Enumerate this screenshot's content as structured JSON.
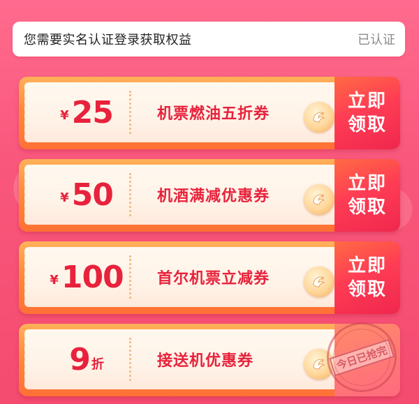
{
  "verify": {
    "text": "您需要实名认证登录获取权益",
    "status": "已认证"
  },
  "coupons": [
    {
      "currency": "¥",
      "value": "25",
      "unit": "",
      "title": "机票燃油五折券",
      "claim_line1": "立即",
      "claim_line2": "领取",
      "badge_icon": "dolphin-logo-icon"
    },
    {
      "currency": "¥",
      "value": "50",
      "unit": "",
      "title": "机酒满减优惠券",
      "claim_line1": "立即",
      "claim_line2": "领取",
      "badge_icon": "dolphin-logo-icon"
    },
    {
      "currency": "¥",
      "value": "100",
      "unit": "",
      "title": "首尔机票立减券",
      "claim_line1": "立即",
      "claim_line2": "领取",
      "badge_icon": "dolphin-logo-icon"
    },
    {
      "currency": "",
      "value": "9",
      "unit": "折",
      "title": "接送机优惠券",
      "stamp": "今日已抢完",
      "badge_icon": "dolphin-logo-icon"
    }
  ],
  "colors": {
    "accent_red": "#e8223c",
    "background_pink": "#f9577c",
    "coupon_orange": "#ff8a3c"
  }
}
